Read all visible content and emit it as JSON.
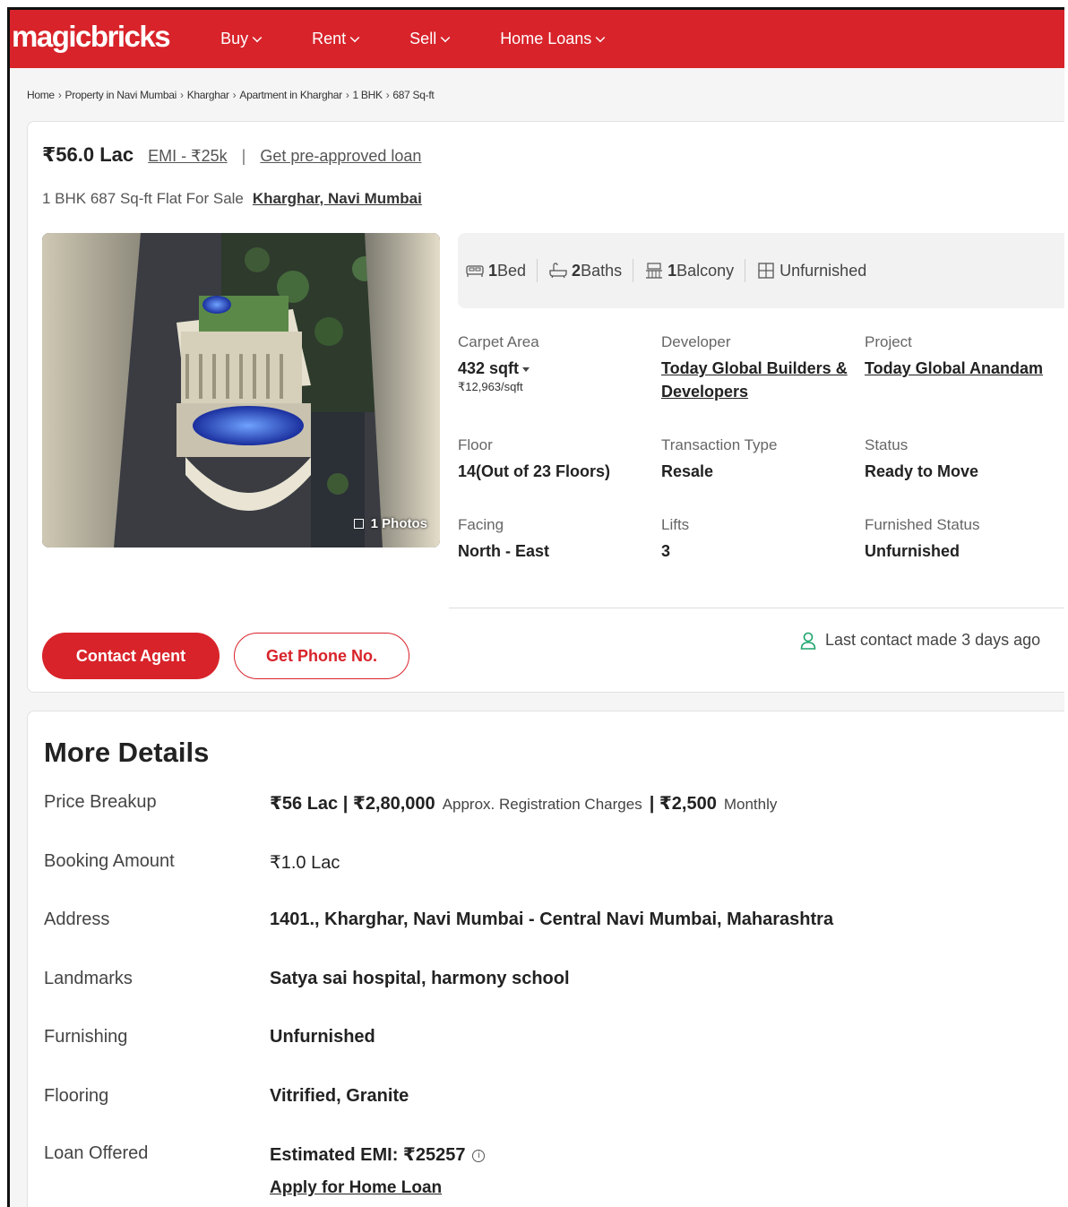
{
  "header": {
    "logo": "magicbricks",
    "brand_color": "#d8232a",
    "nav": [
      {
        "label": "Buy"
      },
      {
        "label": "Rent"
      },
      {
        "label": "Sell"
      },
      {
        "label": "Home Loans"
      }
    ]
  },
  "breadcrumb": [
    "Home",
    "Property in Navi Mumbai",
    "Kharghar",
    "Apartment in Kharghar",
    "1 BHK",
    "687 Sq-ft"
  ],
  "listing": {
    "price": "₹56.0 Lac",
    "emi_link": "EMI - ₹25k",
    "preapproved_link": "Get pre-approved loan",
    "subtitle": "1 BHK 687 Sq-ft Flat For Sale",
    "location_link": "Kharghar, Navi Mumbai",
    "photo_badge": "1 Photos",
    "amenities": [
      {
        "num": "1",
        "label": "Bed",
        "icon": "bed-icon"
      },
      {
        "num": "2",
        "label": "Baths",
        "icon": "bath-icon"
      },
      {
        "num": "1",
        "label": "Balcony",
        "icon": "balcony-icon"
      },
      {
        "num": "",
        "label": "Unfurnished",
        "icon": "furnishing-icon"
      }
    ],
    "specs": {
      "carpet_area": {
        "label": "Carpet Area",
        "value": "432 sqft",
        "sub": "₹12,963/sqft"
      },
      "developer": {
        "label": "Developer",
        "value": "Today Global Builders & Developers"
      },
      "project": {
        "label": "Project",
        "value": "Today Global Anandam"
      },
      "floor": {
        "label": "Floor",
        "value": "14(Out of 23 Floors)"
      },
      "transaction": {
        "label": "Transaction Type",
        "value": "Resale"
      },
      "status": {
        "label": "Status",
        "value": "Ready to Move"
      },
      "facing": {
        "label": "Facing",
        "value": "North - East"
      },
      "lifts": {
        "label": "Lifts",
        "value": "3"
      },
      "furnished": {
        "label": "Furnished Status",
        "value": "Unfurnished"
      }
    },
    "contact_button": "Contact Agent",
    "phone_button": "Get Phone No.",
    "last_contact": "Last contact made 3 days ago"
  },
  "more_details": {
    "title": "More Details",
    "price_breakup": {
      "label": "Price Breakup",
      "price": "₹56 Lac",
      "registration": "₹2,80,000",
      "registration_note": "Approx. Registration Charges",
      "maintenance": "₹2,500",
      "maintenance_note": "Monthly"
    },
    "booking": {
      "label": "Booking Amount",
      "value": "₹1.0 Lac"
    },
    "address": {
      "label": "Address",
      "value": "1401., Kharghar, Navi Mumbai - Central Navi Mumbai, Maharashtra"
    },
    "landmarks": {
      "label": "Landmarks",
      "value": "Satya sai hospital, harmony school"
    },
    "furnishing": {
      "label": "Furnishing",
      "value": "Unfurnished"
    },
    "flooring": {
      "label": "Flooring",
      "value": "Vitrified, Granite"
    },
    "loan": {
      "label": "Loan Offered",
      "value": "Estimated EMI: ₹25257",
      "link": "Apply for Home Loan"
    }
  }
}
